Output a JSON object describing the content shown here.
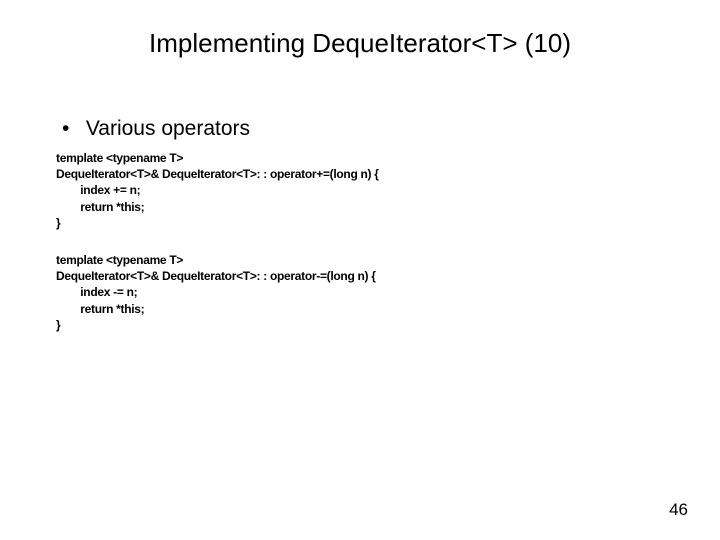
{
  "title": "Implementing DequeIterator<T> (10)",
  "bullet": "Various operators",
  "code_blocks": [
    "template <typename T>\nDequeIterator<T>& DequeIterator<T>: : operator+=(long n) {\n        index += n;\n        return *this;\n}",
    "template <typename T>\nDequeIterator<T>& DequeIterator<T>: : operator-=(long n) {\n        index -= n;\n        return *this;\n}"
  ],
  "page_number": "46"
}
